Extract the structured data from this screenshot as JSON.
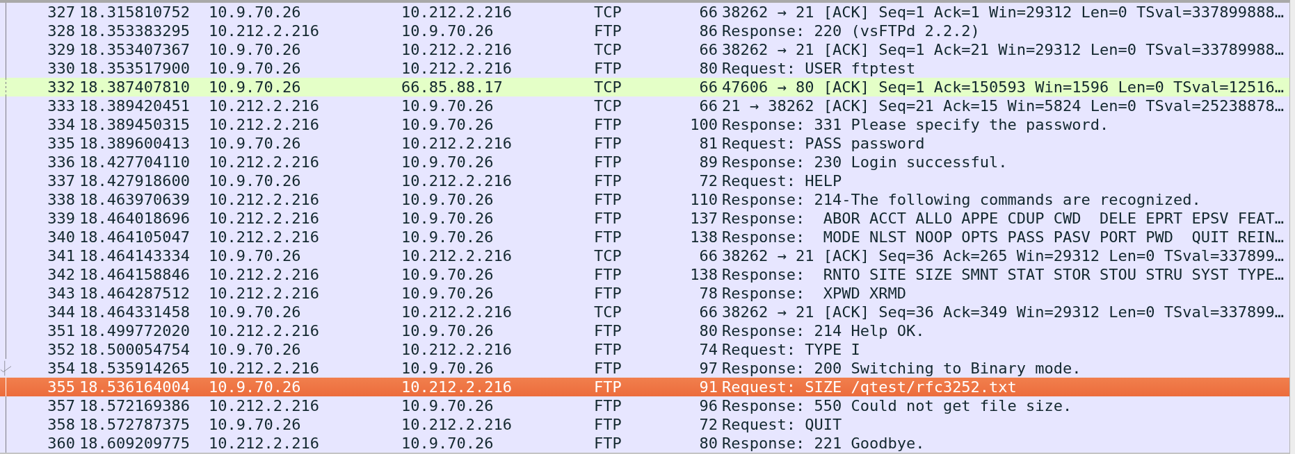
{
  "packet_list": {
    "rows": [
      {
        "no": "327",
        "time": "18.315810752",
        "source": "10.9.70.26",
        "destination": "10.212.2.216",
        "protocol": "TCP",
        "length": "66",
        "info": "38262 → 21 [ACK] Seq=1 Ack=1 Win=29312 Len=0 TSval=337899888…",
        "color": "#e7e6ff",
        "selected": false,
        "in_conversation": true,
        "acknowledged": false
      },
      {
        "no": "328",
        "time": "18.353383295",
        "source": "10.212.2.216",
        "destination": "10.9.70.26",
        "protocol": "FTP",
        "length": "86",
        "info": "Response: 220 (vsFTPd 2.2.2)",
        "color": "#e7e6ff",
        "selected": false,
        "in_conversation": true,
        "acknowledged": false
      },
      {
        "no": "329",
        "time": "18.353407367",
        "source": "10.9.70.26",
        "destination": "10.212.2.216",
        "protocol": "TCP",
        "length": "66",
        "info": "38262 → 21 [ACK] Seq=1 Ack=21 Win=29312 Len=0 TSval=33789988…",
        "color": "#e7e6ff",
        "selected": false,
        "in_conversation": true,
        "acknowledged": false
      },
      {
        "no": "330",
        "time": "18.353517900",
        "source": "10.9.70.26",
        "destination": "10.212.2.216",
        "protocol": "FTP",
        "length": "80",
        "info": "Request: USER ftptest",
        "color": "#e7e6ff",
        "selected": false,
        "in_conversation": true,
        "acknowledged": false
      },
      {
        "no": "332",
        "time": "18.387407810",
        "source": "10.9.70.26",
        "destination": "66.85.88.17",
        "protocol": "TCP",
        "length": "66",
        "info": "47606 → 80 [ACK] Seq=1 Ack=150593 Win=1596 Len=0 TSval=12516…",
        "color": "#e4ffc7",
        "selected": false,
        "in_conversation": false,
        "acknowledged": false
      },
      {
        "no": "333",
        "time": "18.389420451",
        "source": "10.212.2.216",
        "destination": "10.9.70.26",
        "protocol": "TCP",
        "length": "66",
        "info": "21 → 38262 [ACK] Seq=21 Ack=15 Win=5824 Len=0 TSval=25238878…",
        "color": "#e7e6ff",
        "selected": false,
        "in_conversation": true,
        "acknowledged": false
      },
      {
        "no": "334",
        "time": "18.389450315",
        "source": "10.212.2.216",
        "destination": "10.9.70.26",
        "protocol": "FTP",
        "length": "100",
        "info": "Response: 331 Please specify the password.",
        "color": "#e7e6ff",
        "selected": false,
        "in_conversation": true,
        "acknowledged": false
      },
      {
        "no": "335",
        "time": "18.389600413",
        "source": "10.9.70.26",
        "destination": "10.212.2.216",
        "protocol": "FTP",
        "length": "81",
        "info": "Request: PASS password",
        "color": "#e7e6ff",
        "selected": false,
        "in_conversation": true,
        "acknowledged": false
      },
      {
        "no": "336",
        "time": "18.427704110",
        "source": "10.212.2.216",
        "destination": "10.9.70.26",
        "protocol": "FTP",
        "length": "89",
        "info": "Response: 230 Login successful.",
        "color": "#e7e6ff",
        "selected": false,
        "in_conversation": true,
        "acknowledged": false
      },
      {
        "no": "337",
        "time": "18.427918600",
        "source": "10.9.70.26",
        "destination": "10.212.2.216",
        "protocol": "FTP",
        "length": "72",
        "info": "Request: HELP",
        "color": "#e7e6ff",
        "selected": false,
        "in_conversation": true,
        "acknowledged": false
      },
      {
        "no": "338",
        "time": "18.463970639",
        "source": "10.212.2.216",
        "destination": "10.9.70.26",
        "protocol": "FTP",
        "length": "110",
        "info": "Response: 214-The following commands are recognized.",
        "color": "#e7e6ff",
        "selected": false,
        "in_conversation": true,
        "acknowledged": false
      },
      {
        "no": "339",
        "time": "18.464018696",
        "source": "10.212.2.216",
        "destination": "10.9.70.26",
        "protocol": "FTP",
        "length": "137",
        "info": "Response:  ABOR ACCT ALLO APPE CDUP CWD  DELE EPRT EPSV FEAT…",
        "color": "#e7e6ff",
        "selected": false,
        "in_conversation": true,
        "acknowledged": false
      },
      {
        "no": "340",
        "time": "18.464105047",
        "source": "10.212.2.216",
        "destination": "10.9.70.26",
        "protocol": "FTP",
        "length": "138",
        "info": "Response:  MODE NLST NOOP OPTS PASS PASV PORT PWD  QUIT REIN…",
        "color": "#e7e6ff",
        "selected": false,
        "in_conversation": true,
        "acknowledged": false
      },
      {
        "no": "341",
        "time": "18.464143334",
        "source": "10.9.70.26",
        "destination": "10.212.2.216",
        "protocol": "TCP",
        "length": "66",
        "info": "38262 → 21 [ACK] Seq=36 Ack=265 Win=29312 Len=0 TSval=337899…",
        "color": "#e7e6ff",
        "selected": false,
        "in_conversation": true,
        "acknowledged": false
      },
      {
        "no": "342",
        "time": "18.464158846",
        "source": "10.212.2.216",
        "destination": "10.9.70.26",
        "protocol": "FTP",
        "length": "138",
        "info": "Response:  RNTO SITE SIZE SMNT STAT STOR STOU STRU SYST TYPE…",
        "color": "#e7e6ff",
        "selected": false,
        "in_conversation": true,
        "acknowledged": false
      },
      {
        "no": "343",
        "time": "18.464287512",
        "source": "10.212.2.216",
        "destination": "10.9.70.26",
        "protocol": "FTP",
        "length": "78",
        "info": "Response:  XPWD XRMD",
        "color": "#e7e6ff",
        "selected": false,
        "in_conversation": true,
        "acknowledged": false
      },
      {
        "no": "344",
        "time": "18.464331458",
        "source": "10.9.70.26",
        "destination": "10.212.2.216",
        "protocol": "TCP",
        "length": "66",
        "info": "38262 → 21 [ACK] Seq=36 Ack=349 Win=29312 Len=0 TSval=337899…",
        "color": "#e7e6ff",
        "selected": false,
        "in_conversation": true,
        "acknowledged": false
      },
      {
        "no": "351",
        "time": "18.499772020",
        "source": "10.212.2.216",
        "destination": "10.9.70.26",
        "protocol": "FTP",
        "length": "80",
        "info": "Response: 214 Help OK.",
        "color": "#e7e6ff",
        "selected": false,
        "in_conversation": true,
        "acknowledged": false
      },
      {
        "no": "352",
        "time": "18.500054754",
        "source": "10.9.70.26",
        "destination": "10.212.2.216",
        "protocol": "FTP",
        "length": "74",
        "info": "Request: TYPE I",
        "color": "#e7e6ff",
        "selected": false,
        "in_conversation": true,
        "acknowledged": false
      },
      {
        "no": "354",
        "time": "18.535914265",
        "source": "10.212.2.216",
        "destination": "10.9.70.26",
        "protocol": "FTP",
        "length": "97",
        "info": "Response: 200 Switching to Binary mode.",
        "color": "#e7e6ff",
        "selected": false,
        "in_conversation": true,
        "acknowledged": true
      },
      {
        "no": "355",
        "time": "18.536164004",
        "source": "10.9.70.26",
        "destination": "10.212.2.216",
        "protocol": "FTP",
        "length": "91",
        "info": "Request: SIZE /qtest/rfc3252.txt",
        "selected": true,
        "in_conversation": true,
        "acknowledged": false
      },
      {
        "no": "357",
        "time": "18.572169386",
        "source": "10.212.2.216",
        "destination": "10.9.70.26",
        "protocol": "FTP",
        "length": "96",
        "info": "Response: 550 Could not get file size.",
        "color": "#e7e6ff",
        "selected": false,
        "in_conversation": true,
        "acknowledged": false
      },
      {
        "no": "358",
        "time": "18.572787375",
        "source": "10.9.70.26",
        "destination": "10.212.2.216",
        "protocol": "FTP",
        "length": "72",
        "info": "Request: QUIT",
        "color": "#e7e6ff",
        "selected": false,
        "in_conversation": true,
        "acknowledged": false
      },
      {
        "no": "360",
        "time": "18.609209775",
        "source": "10.212.2.216",
        "destination": "10.9.70.26",
        "protocol": "FTP",
        "length": "80",
        "info": "Response: 221 Goodbye.",
        "color": "#e7e6ff",
        "selected": false,
        "in_conversation": true,
        "acknowledged": false
      }
    ]
  }
}
